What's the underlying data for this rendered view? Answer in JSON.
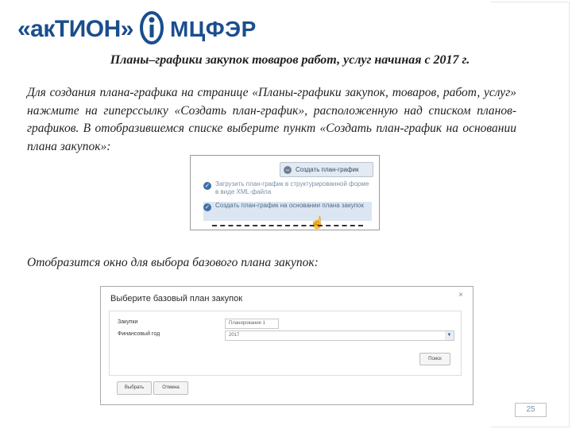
{
  "header": {
    "logo_left": "«акТИОН»",
    "logo_right": "МЦФЭР"
  },
  "slide": {
    "title": "Планы–графики закупок товаров  работ, услуг начиная с 2017 г.",
    "paragraph": "Для создания плана-графика на странице «Планы-графики закупок, товаров, работ, услуг» нажмите на гиперссылку «Создать план-график», расположенную над списком планов-графиков. В отобразившемся списке выберите пункт «Создать план-график на основании плана закупок»:",
    "caption2": "Отобразится окно для выбора базового плана закупок:",
    "page_number": "25"
  },
  "screenshot1": {
    "button": "Создать план-график",
    "option1": "Загрузить план-график в структурированной форме в виде XML-файла",
    "option2": "Создать план-график на основании плана закупок"
  },
  "screenshot2": {
    "title": "Выберите базовый план закупок",
    "close": "×",
    "field1_label": "Закупки",
    "field1_value": "Планирование 1",
    "field2_label": "Финансовый год",
    "field2_value": "2017",
    "search_button": "Поиск",
    "choose_button": "Выбрать",
    "cancel_button": "Отмена"
  },
  "colors": {
    "brand": "#1a4e8d"
  }
}
